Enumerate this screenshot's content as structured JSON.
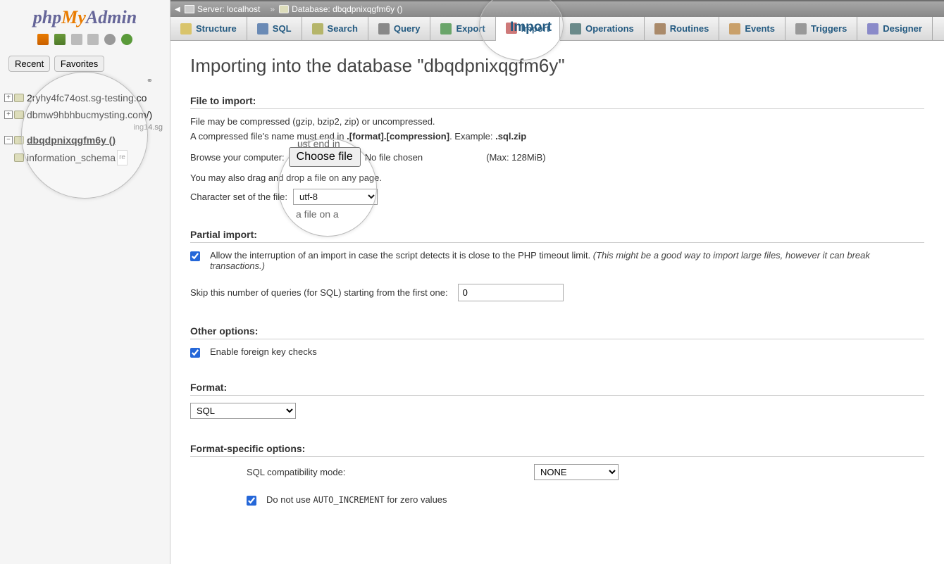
{
  "logo": {
    "php": "php",
    "my": "My",
    "admin": "Admin"
  },
  "sidebar": {
    "tabs": {
      "recent": "Recent",
      "favorites": "Favorites"
    },
    "link_icon": "⚭",
    "dbs": [
      {
        "name": "2ryhy4fc74ost.sg-testing.co"
      },
      {
        "name": "dbmw9hbhbucmysting.com/)"
      },
      {
        "name": "dbqdpnixqgfm6y ()",
        "selected": true
      },
      {
        "name": "information_schema"
      }
    ],
    "badge_text": "re",
    "extra_text": "ing14.sg"
  },
  "breadcrumb": {
    "server_label": "Server: localhost",
    "sep": "»",
    "db_label": "Database: dbqdpnixqgfm6y ()"
  },
  "tabs": [
    {
      "key": "structure",
      "label": "Structure"
    },
    {
      "key": "sql",
      "label": "SQL"
    },
    {
      "key": "search",
      "label": "Search"
    },
    {
      "key": "query",
      "label": "Query"
    },
    {
      "key": "export",
      "label": "Export"
    },
    {
      "key": "import",
      "label": "Import",
      "active": true
    },
    {
      "key": "operations",
      "label": "Operations"
    },
    {
      "key": "routines",
      "label": "Routines"
    },
    {
      "key": "events",
      "label": "Events"
    },
    {
      "key": "triggers",
      "label": "Triggers"
    },
    {
      "key": "designer",
      "label": "Designer"
    }
  ],
  "page": {
    "title": "Importing into the database \"dbqdpnixqgfm6y\"",
    "file_to_import": "File to import:",
    "file_compressed": "File may be compressed (gzip, bzip2, zip) or uncompressed.",
    "compressed_prefix": "A compressed file's name must end in ",
    "compressed_bold1": ".[format].[compression]",
    "compressed_mid": ". Example: ",
    "compressed_bold2": ".sql.zip",
    "browse_label": "Browse your computer:",
    "choose_file": "Choose file",
    "no_file": "No file chosen",
    "max_size": "(Max: 128MiB)",
    "drag_hint": "You may also drag and drop a file on any page.",
    "charset_label": "Character set of the file:",
    "charset_value": "utf-8",
    "partial_import": "Partial import:",
    "allow_interrupt_main": "Allow the interruption of an import in case the script detects it is close to the PHP timeout limit. ",
    "allow_interrupt_note": "(This might be a good way to import large files, however it can break transactions.)",
    "skip_label": "Skip this number of queries (for SQL) starting from the first one:",
    "skip_value": "0",
    "other_options": "Other options:",
    "fk_label": "Enable foreign key checks",
    "format": "Format:",
    "format_value": "SQL",
    "fs_options": "Format-specific options:",
    "compat_label": "SQL compatibility mode:",
    "compat_value": "NONE",
    "auto_inc_pre": "Do not use ",
    "auto_inc_code": "AUTO_INCREMENT",
    "auto_inc_post": " for zero values"
  },
  "lens": {
    "sub1": "ust end in",
    "sub2": "a file on a",
    "import_big": "Import"
  }
}
